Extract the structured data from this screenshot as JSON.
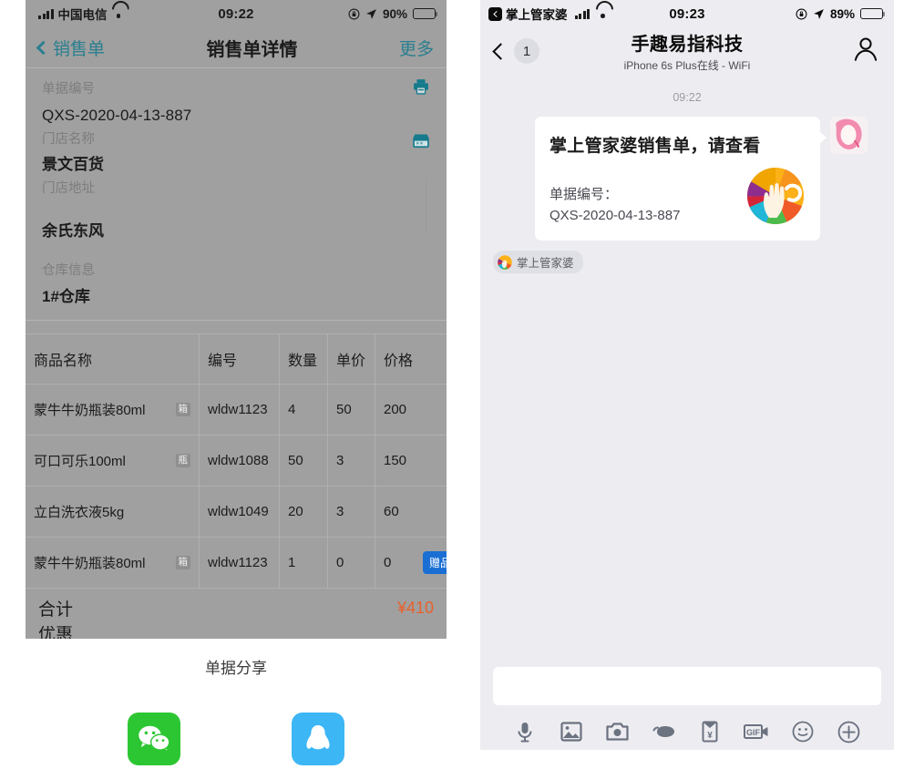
{
  "left_phone": {
    "status_bar": {
      "carrier": "中国电信",
      "time": "09:22",
      "battery_percent": "90%",
      "signal_icon": "cellular-signal-icon",
      "wifi_icon": "wifi-icon",
      "location_icon": "location-arrow-icon",
      "lock_icon": "rotation-lock-icon",
      "battery_icon": "battery-icon"
    },
    "nav": {
      "back_label": "销售单",
      "title": "销售单详情",
      "more_label": "更多",
      "back_icon": "chevron-left-icon"
    },
    "order_info": [
      {
        "label": "单据编号",
        "value": "QXS-2020-04-13-887",
        "icon": "printer-icon"
      },
      {
        "label": "门店名称",
        "value": "景文百货",
        "icon": "store-icon"
      },
      {
        "label": "门店地址",
        "value": "余氏东风",
        "icon": ""
      },
      {
        "label": "仓库信息",
        "value": "1#仓库",
        "icon": ""
      }
    ],
    "table": {
      "headers": [
        "商品名称",
        "编号",
        "数量",
        "单价",
        "价格"
      ],
      "rows": [
        {
          "name": "蒙牛牛奶瓶装80ml",
          "unit": "箱",
          "code": "wldw1123",
          "qty": "4",
          "price": "50",
          "amount": "200",
          "badge": ""
        },
        {
          "name": "可口可乐100ml",
          "unit": "瓶",
          "code": "wldw1088",
          "qty": "50",
          "price": "3",
          "amount": "150",
          "badge": ""
        },
        {
          "name": "立白洗衣液5kg",
          "unit": "",
          "code": "wldw1049",
          "qty": "20",
          "price": "3",
          "amount": "60",
          "badge": ""
        },
        {
          "name": "蒙牛牛奶瓶装80ml",
          "unit": "箱",
          "code": "wldw1123",
          "qty": "1",
          "price": "0",
          "amount": "0",
          "badge": "赠品"
        }
      ],
      "total_label": "合计",
      "total_value": "¥410",
      "cut_off_row_label": "优惠"
    },
    "share": {
      "title": "单据分享",
      "wechat_label": "wechat-share",
      "qq_label": "qq-share",
      "wechat_color": "#2cc632",
      "qq_color": "#3cb6f5"
    }
  },
  "right_phone": {
    "status_bar": {
      "back_app": "掌上管家婆",
      "time": "09:23",
      "battery_percent": "89%",
      "signal_icon": "cellular-signal-icon",
      "wifi_icon": "wifi-icon",
      "location_icon": "location-arrow-icon",
      "lock_icon": "rotation-lock-icon",
      "battery_icon": "battery-icon"
    },
    "nav": {
      "unread_count": "1",
      "title": "手趣易指科技",
      "subtitle": "iPhone 6s Plus在线 - WiFi",
      "back_icon": "chevron-left-icon",
      "contact_icon": "person-icon"
    },
    "chat": {
      "timestamp": "09:22",
      "message": {
        "title": "掌上管家婆销售单，请查看",
        "sub_label": "单据编号：",
        "sub_value": "QXS-2020-04-13-887",
        "thumbnail_icon": "guanjiapo-logo-icon"
      },
      "source_tag": "掌上管家婆",
      "avatar_icon": "contact-avatar"
    },
    "composer": {
      "input_placeholder": "",
      "input_value": "",
      "tools": [
        "microphone-icon",
        "photo-icon",
        "camera-icon",
        "handshake-icon",
        "red-packet-icon",
        "gif-icon",
        "emoji-icon",
        "plus-icon"
      ]
    }
  }
}
